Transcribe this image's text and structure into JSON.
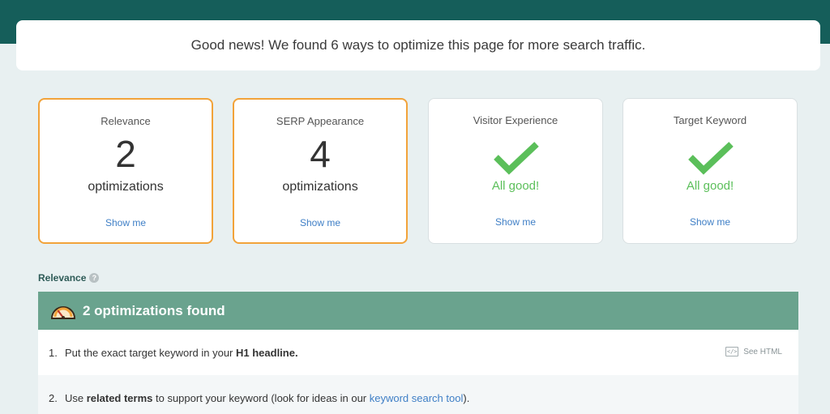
{
  "banner": {
    "text": "Good news! We found 6 ways to optimize this page for more search traffic."
  },
  "cards": [
    {
      "title": "Relevance",
      "count": "2",
      "unit": "optimizations",
      "status": "warn",
      "link": "Show me"
    },
    {
      "title": "SERP Appearance",
      "count": "4",
      "unit": "optimizations",
      "status": "warn",
      "link": "Show me"
    },
    {
      "title": "Visitor Experience",
      "good": "All good!",
      "status": "good",
      "icon": "checkmark-icon",
      "link": "Show me"
    },
    {
      "title": "Target Keyword",
      "good": "All good!",
      "status": "good",
      "icon": "checkmark-icon",
      "link": "Show me"
    }
  ],
  "section": {
    "label": "Relevance",
    "help_icon": "?"
  },
  "optimizations": {
    "header": "2 optimizations found",
    "icon": "gauge-icon",
    "items": [
      {
        "num": "1.",
        "text_before": "Put the exact target keyword in your ",
        "bold": "H1 headline.",
        "action_label": "See HTML",
        "action_icon_text": "</>"
      },
      {
        "num": "2.",
        "text_before": "Use ",
        "bold": "related terms",
        "text_middle": " to support your keyword (look for ideas in our ",
        "link": "keyword search tool",
        "text_after": ")."
      }
    ]
  },
  "colors": {
    "topbar": "#155e5a",
    "header_bar": "#6aa38e",
    "warn_border": "#f2a33a",
    "good_green": "#5bbf5a",
    "link_blue": "#3f7fc6"
  }
}
